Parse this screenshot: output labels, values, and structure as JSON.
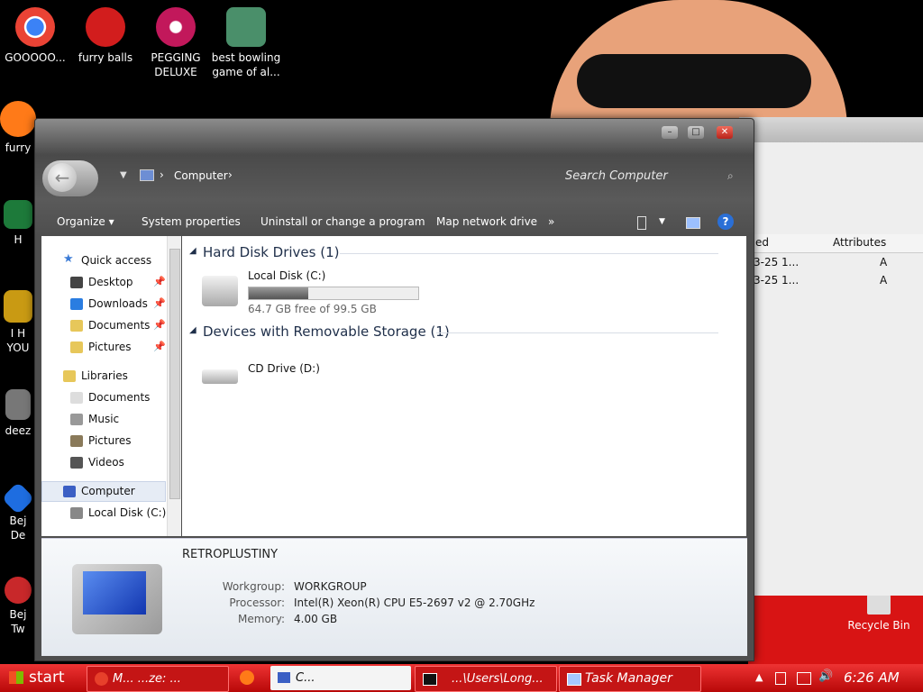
{
  "desktop": {
    "icons": [
      {
        "label": "GOOOOO...",
        "color": "#e7402b"
      },
      {
        "label": "furry balls",
        "color": "#d21d1d"
      },
      {
        "label": "PEGGING DELUXE",
        "color": "#c2185b"
      },
      {
        "label": "best bowling game of al...",
        "color": "#4a8f6a"
      },
      {
        "label": "furry",
        "color": "#ff7a18"
      },
      {
        "label": "H",
        "color": "#1d7a3a"
      },
      {
        "label": "I H YOU",
        "color": "#c99a13"
      },
      {
        "label": "deez",
        "color": "#666666"
      },
      {
        "label": "Bej De",
        "color": "#1e6de0"
      },
      {
        "label": "Bej Tw",
        "color": "#c8282a"
      },
      {
        "label": "Recycle Bin",
        "color": "#dddddd"
      }
    ]
  },
  "back_window": {
    "columns": [
      "ed",
      "Attributes"
    ],
    "rows": [
      {
        "date": "3-25 1...",
        "attr": "A"
      },
      {
        "date": "3-25 1...",
        "attr": "A"
      }
    ]
  },
  "window": {
    "controls": {
      "minimize": "–",
      "maximize": "□",
      "close": "✕"
    },
    "address": {
      "crumb": "Computer",
      "sep": "›"
    },
    "search_placeholder": "Search Computer",
    "toolbar": {
      "organize": "Organize ▾",
      "system_properties": "System properties",
      "uninstall": "Uninstall or change a program",
      "map_drive": "Map network drive",
      "more": "»",
      "help": "?"
    },
    "nav": {
      "quick_access": "Quick access",
      "quick_items": [
        "Desktop",
        "Downloads",
        "Documents",
        "Pictures"
      ],
      "libraries": "Libraries",
      "library_items": [
        "Documents",
        "Music",
        "Pictures",
        "Videos"
      ],
      "computer": "Computer",
      "computer_items": [
        "Local Disk (C:)"
      ]
    },
    "content": {
      "group1": "Hard Disk Drives (1)",
      "drive_c_name": "Local Disk (C:)",
      "drive_c_free": "64.7 GB free of 99.5 GB",
      "drive_c_used_fraction": 0.35,
      "group2": "Devices with Removable Storage (1)",
      "drive_d_name": "CD Drive (D:)"
    },
    "details": {
      "computer_name": "RETROPLUSTINY",
      "workgroup_label": "Workgroup:",
      "workgroup": "WORKGROUP",
      "processor_label": "Processor:",
      "processor": "Intel(R) Xeon(R) CPU E5-2697 v2 @ 2.70GHz",
      "memory_label": "Memory:",
      "memory": "4.00 GB"
    }
  },
  "taskbar": {
    "start": "start",
    "tasks": [
      {
        "label": "M... ...ze: ..."
      },
      {
        "label": "C..."
      },
      {
        "label": "...\\Users\\Long..."
      },
      {
        "label": "Task Manager"
      }
    ],
    "clock": "6:26 AM"
  }
}
